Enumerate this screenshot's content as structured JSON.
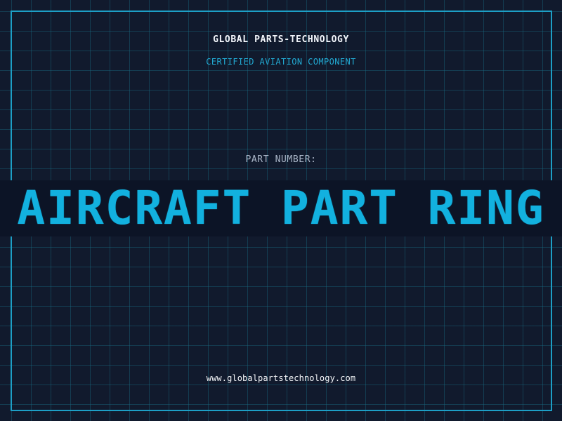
{
  "header": {
    "company_name": "GLOBAL PARTS-TECHNOLOGY",
    "certification": "CERTIFIED AVIATION COMPONENT"
  },
  "part": {
    "label": "PART NUMBER:",
    "name": "AIRCRAFT PART RING"
  },
  "footer": {
    "website": "www.globalpartstechnology.com"
  },
  "colors": {
    "background": "#111a2d",
    "grid": "#186d84",
    "frame": "#1d9fc6",
    "accent": "#12b1df",
    "title_band": "#0c1426"
  }
}
